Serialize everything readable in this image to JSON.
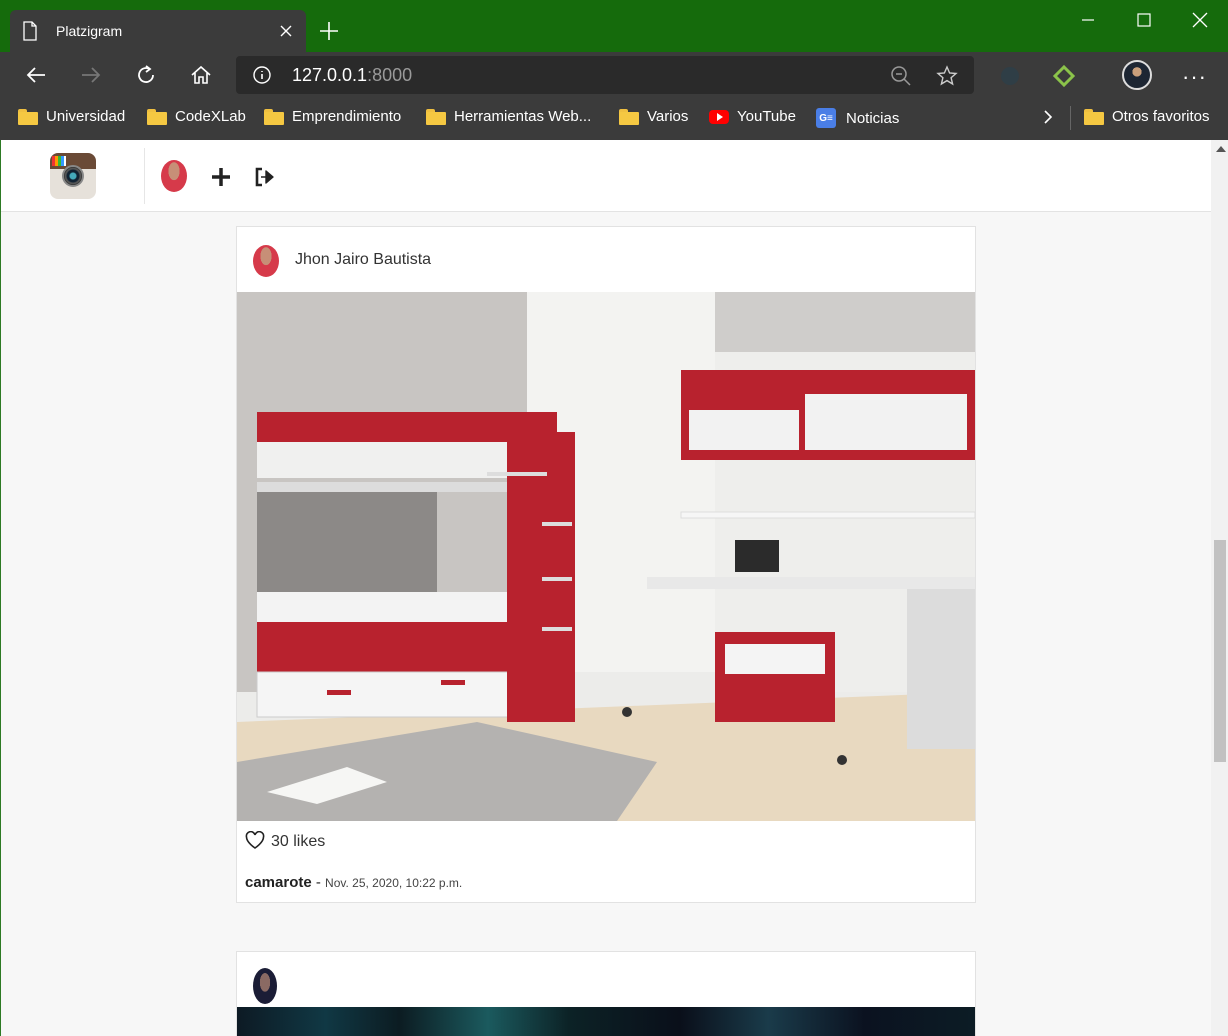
{
  "browser": {
    "tab_title": "Platzigram",
    "url_host": "127.0.0.1",
    "url_port": ":8000",
    "bookmarks": [
      {
        "label": "Universidad",
        "icon": "folder-icon"
      },
      {
        "label": "CodeXLab",
        "icon": "folder-icon"
      },
      {
        "label": "Emprendimiento",
        "icon": "folder-icon"
      },
      {
        "label": "Herramientas Web...",
        "icon": "folder-icon"
      },
      {
        "label": "Varios",
        "icon": "folder-icon"
      },
      {
        "label": "YouTube",
        "icon": "youtube-icon"
      },
      {
        "label": "Noticias",
        "icon": "google-news-icon"
      }
    ],
    "other_favorites": "Otros favoritos",
    "news_icon_text": "G≡"
  },
  "post": {
    "username": "Jhon Jairo Bautista",
    "likes": "30 likes",
    "author": "camarote",
    "separator": " - ",
    "date": "Nov. 25, 2020, 10:22 p.m."
  },
  "colors": {
    "titlebar": "#156b0c",
    "chrome": "#3b3b3b",
    "accent_red": "#b8222e"
  }
}
